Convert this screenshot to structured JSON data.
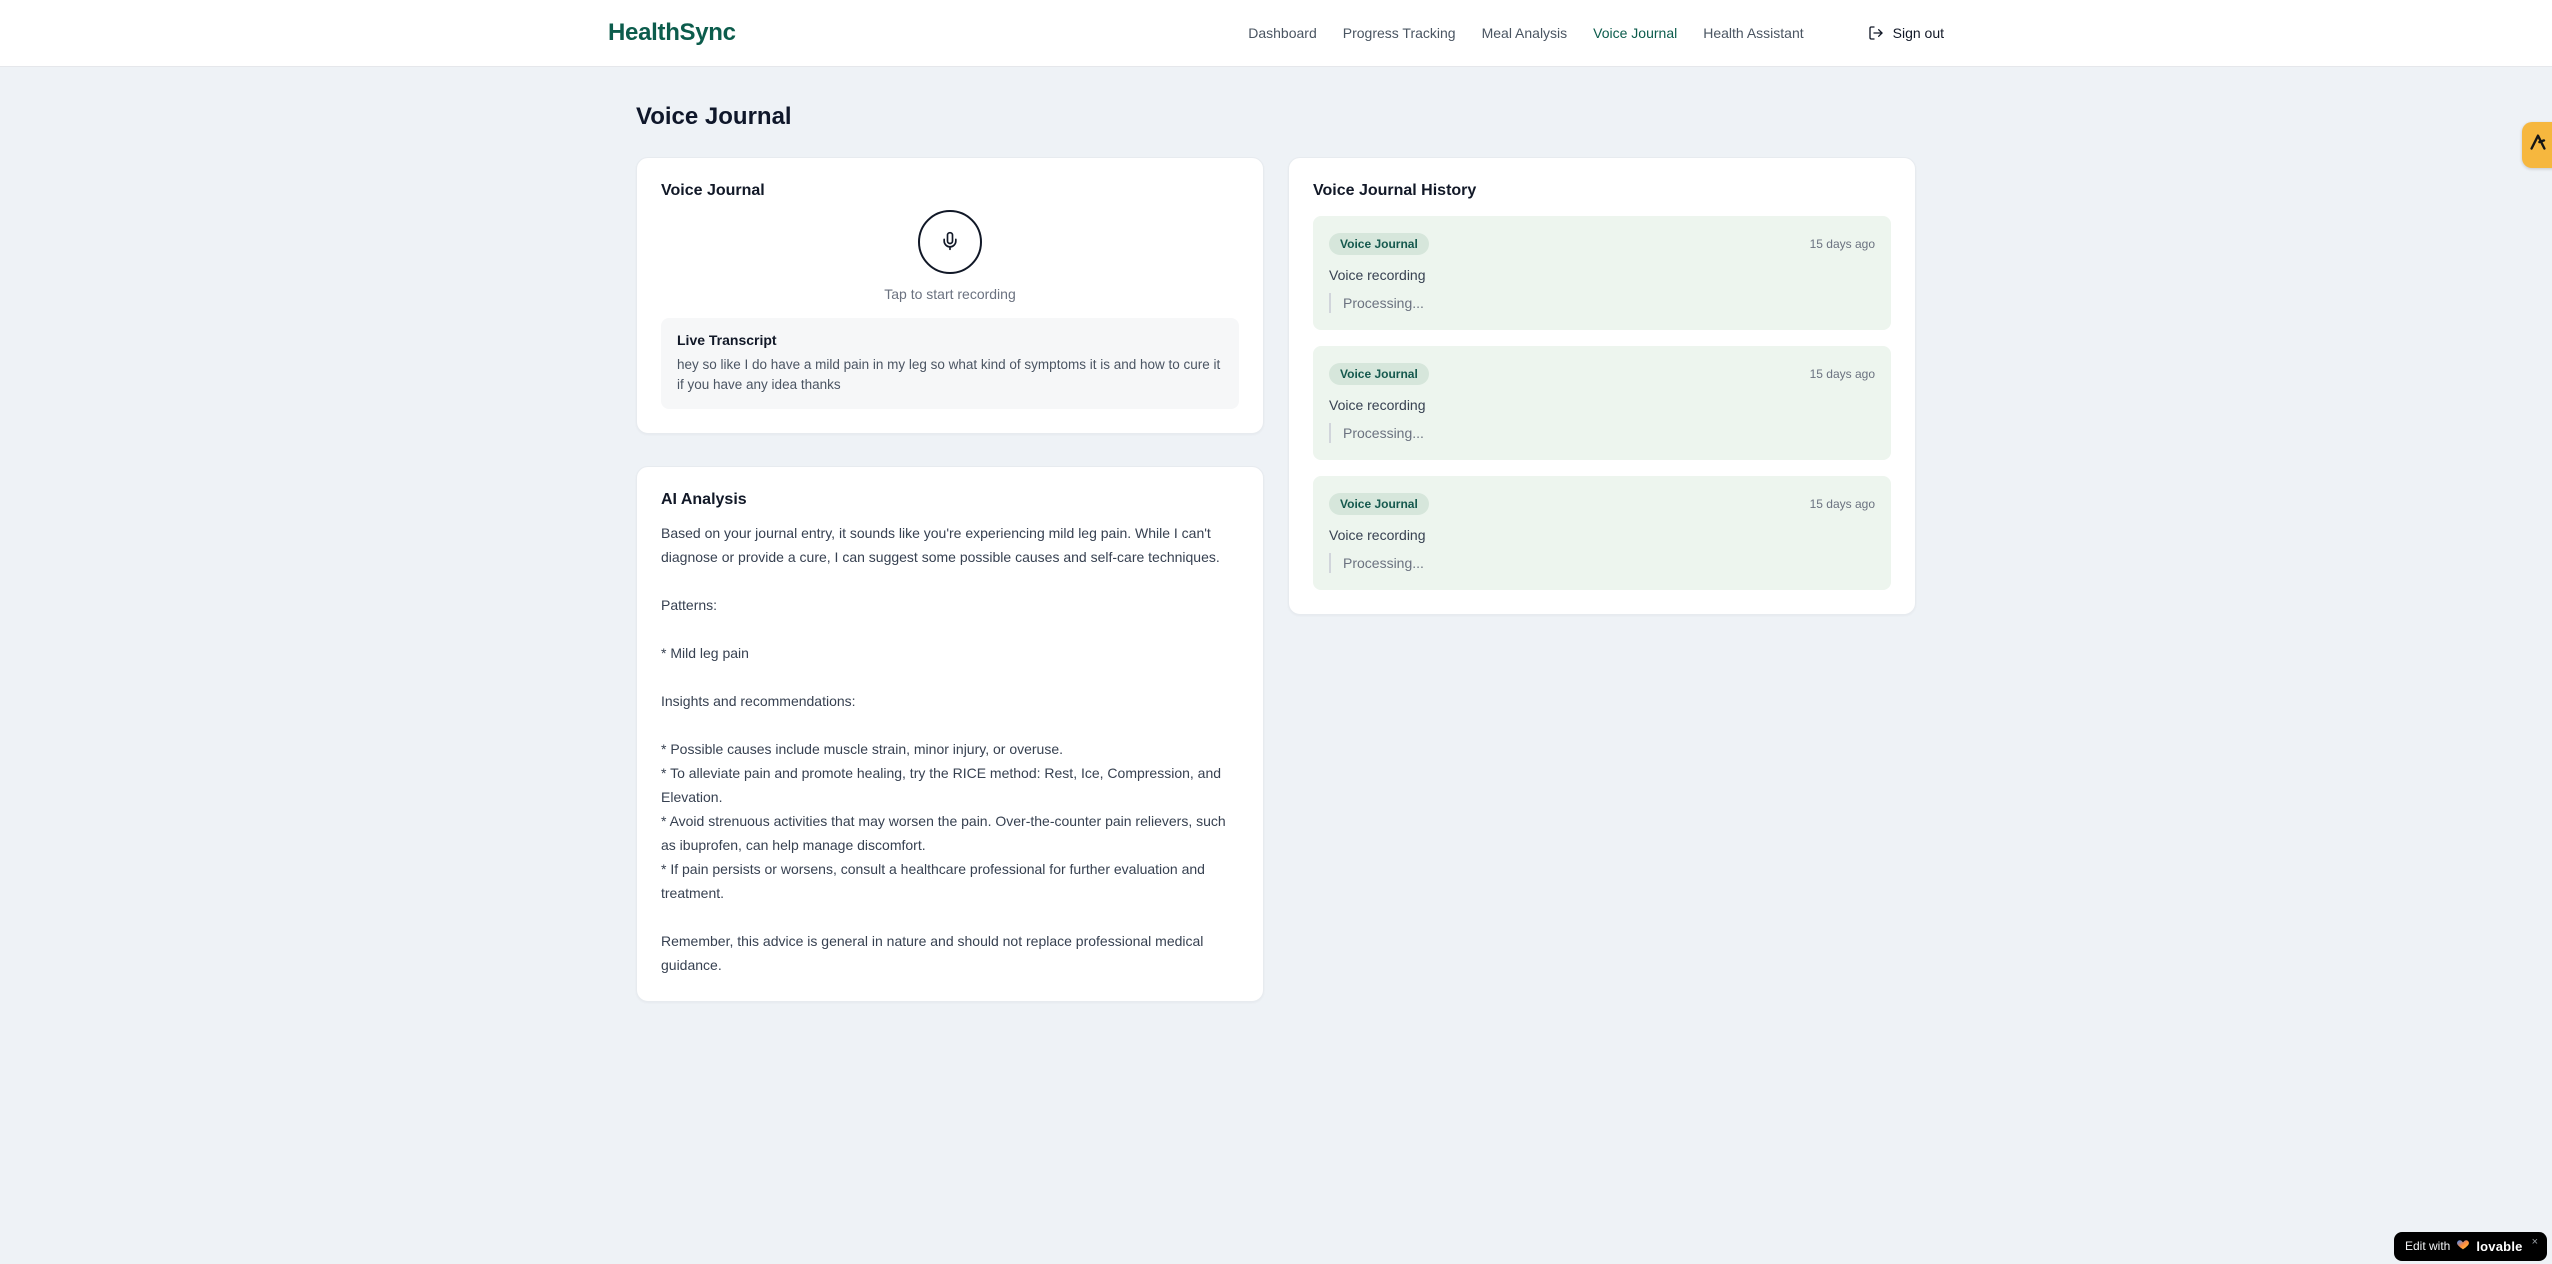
{
  "header": {
    "brand": "HealthSync",
    "nav": [
      {
        "label": "Dashboard",
        "active": false
      },
      {
        "label": "Progress Tracking",
        "active": false
      },
      {
        "label": "Meal Analysis",
        "active": false
      },
      {
        "label": "Voice Journal",
        "active": true
      },
      {
        "label": "Health Assistant",
        "active": false
      }
    ],
    "sign_out_label": "Sign out",
    "sign_out_icon": "log-out-icon"
  },
  "page": {
    "title": "Voice Journal"
  },
  "recorder_card": {
    "title": "Voice Journal",
    "mic_icon": "microphone-icon",
    "tap_hint": "Tap to start recording",
    "transcript": {
      "title": "Live Transcript",
      "text": "hey so like I do have a mild pain in my leg so what kind of symptoms it is and how to cure it if you have any idea thanks"
    }
  },
  "analysis_card": {
    "title": "AI Analysis",
    "body": "Based on your journal entry, it sounds like you're experiencing mild leg pain. While I can't diagnose or provide a cure, I can suggest some possible causes and self-care techniques.\n\nPatterns:\n\n* Mild leg pain\n\nInsights and recommendations:\n\n* Possible causes include muscle strain, minor injury, or overuse.\n* To alleviate pain and promote healing, try the RICE method: Rest, Ice, Compression, and Elevation.\n* Avoid strenuous activities that may worsen the pain. Over-the-counter pain relievers, such as ibuprofen, can help manage discomfort.\n* If pain persists or worsens, consult a healthcare professional for further evaluation and treatment.\n\nRemember, this advice is general in nature and should not replace professional medical guidance."
  },
  "history_card": {
    "title": "Voice Journal History",
    "entries": [
      {
        "badge": "Voice Journal",
        "time": "15 days ago",
        "label": "Voice recording",
        "status": "Processing..."
      },
      {
        "badge": "Voice Journal",
        "time": "15 days ago",
        "label": "Voice recording",
        "status": "Processing..."
      },
      {
        "badge": "Voice Journal",
        "time": "15 days ago",
        "label": "Voice recording",
        "status": "Processing..."
      }
    ]
  },
  "floating": {
    "side_widget_icon": "widget-logo-icon",
    "lovable": {
      "prefix": "Edit with",
      "heart_icon": "heart-icon",
      "brand": "lovable",
      "close": "×"
    }
  },
  "colors": {
    "brand_teal": "#0c5c4c",
    "page_background": "#eef2f6",
    "history_entry_background": "#edf5ee",
    "badge_background": "#d6e6db",
    "badge_text": "#15594e",
    "side_widget_amber": "#f6b73e",
    "lovable_black": "#000000"
  }
}
